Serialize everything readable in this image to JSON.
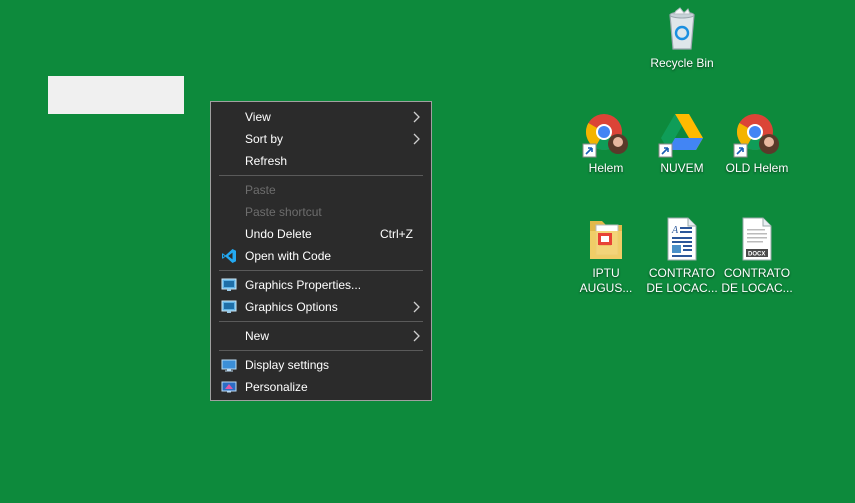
{
  "rename_box": {
    "value": ""
  },
  "context_menu": {
    "items": [
      {
        "label": "View",
        "shortcut": "",
        "submenu": true,
        "enabled": true,
        "icon": ""
      },
      {
        "label": "Sort by",
        "shortcut": "",
        "submenu": true,
        "enabled": true,
        "icon": ""
      },
      {
        "label": "Refresh",
        "shortcut": "",
        "submenu": false,
        "enabled": true,
        "icon": ""
      },
      {
        "label": "Paste",
        "shortcut": "",
        "submenu": false,
        "enabled": false,
        "icon": ""
      },
      {
        "label": "Paste shortcut",
        "shortcut": "",
        "submenu": false,
        "enabled": false,
        "icon": ""
      },
      {
        "label": "Undo Delete",
        "shortcut": "Ctrl+Z",
        "submenu": false,
        "enabled": true,
        "icon": ""
      },
      {
        "label": "Open with Code",
        "shortcut": "",
        "submenu": false,
        "enabled": true,
        "icon": "vscode-icon"
      },
      {
        "label": "Graphics Properties...",
        "shortcut": "",
        "submenu": false,
        "enabled": true,
        "icon": "intel-graphics-icon"
      },
      {
        "label": "Graphics Options",
        "shortcut": "",
        "submenu": true,
        "enabled": true,
        "icon": "intel-graphics-icon"
      },
      {
        "label": "New",
        "shortcut": "",
        "submenu": true,
        "enabled": true,
        "icon": ""
      },
      {
        "label": "Display settings",
        "shortcut": "",
        "submenu": false,
        "enabled": true,
        "icon": "display-icon"
      },
      {
        "label": "Personalize",
        "shortcut": "",
        "submenu": false,
        "enabled": true,
        "icon": "personalize-icon"
      }
    ]
  },
  "desktop_icons": [
    {
      "label": "Recycle Bin",
      "icon": "recycle-bin-icon"
    },
    {
      "label": "Helem",
      "icon": "chrome-shortcut-icon"
    },
    {
      "label": "NUVEM",
      "icon": "google-drive-shortcut-icon"
    },
    {
      "label": "OLD Helem",
      "icon": "chrome-shortcut-icon"
    },
    {
      "label": "IPTU AUGUS...",
      "icon": "folder-pdf-icon"
    },
    {
      "label": "CONTRATO DE LOCAC...",
      "icon": "word-document-icon"
    },
    {
      "label": "CONTRATO DE LOCAC...",
      "icon": "docx-file-icon"
    }
  ],
  "colors": {
    "desktop_background": "#0d8a3c",
    "menu_background": "#2b2b2b",
    "menu_disabled_text": "#6d6d6d"
  }
}
